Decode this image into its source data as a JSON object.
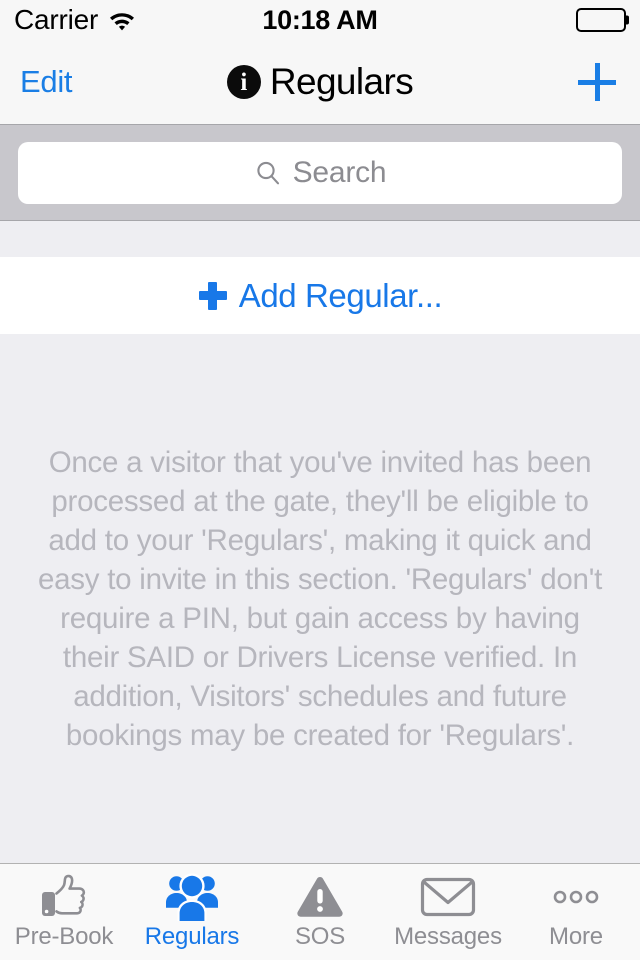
{
  "status_bar": {
    "carrier": "Carrier",
    "wifi_icon": "wifi-icon",
    "time": "10:18 AM",
    "battery_icon": "battery-full-icon"
  },
  "nav_bar": {
    "edit_label": "Edit",
    "info_icon": "info-circle-icon",
    "info_glyph": "i",
    "title": "Regulars",
    "add_icon": "plus-icon"
  },
  "search": {
    "icon": "search-icon",
    "placeholder": "Search",
    "value": ""
  },
  "list": {
    "add_icon": "plus-icon",
    "add_label": "Add Regular...",
    "empty_message": "Once a visitor that you've invited has been processed at the gate, they'll be eligible to add to your 'Regulars', making it quick and easy to invite in this section. 'Regulars' don't require a PIN, but gain access by having their SAID or Drivers License verified. In addition, Visitors' schedules and future bookings may be created for 'Regulars'."
  },
  "tab_bar": {
    "items": [
      {
        "label": "Pre-Book",
        "icon": "thumbs-up-icon",
        "active": false
      },
      {
        "label": "Regulars",
        "icon": "people-group-icon",
        "active": true
      },
      {
        "label": "SOS",
        "icon": "warning-triangle-icon",
        "active": false
      },
      {
        "label": "Messages",
        "icon": "envelope-icon",
        "active": false
      },
      {
        "label": "More",
        "icon": "ellipsis-icon",
        "active": false
      }
    ]
  },
  "colors": {
    "accent_blue": "#1878e8",
    "nav_blue": "#1a7ee5",
    "inactive_gray": "#8e8e93",
    "placeholder_gray": "#b6b6bd",
    "nav_bg": "#f7f7f7",
    "search_bg": "#c8c7cc",
    "content_bg": "#eeeef2",
    "tabbar_bg": "#f9f9f9"
  }
}
